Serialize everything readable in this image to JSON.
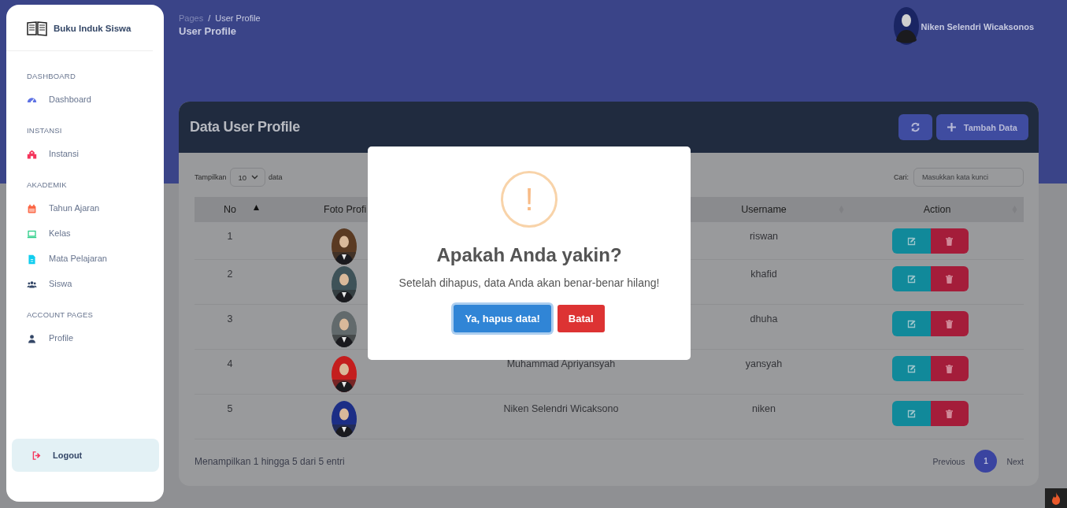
{
  "sidebar": {
    "brand": "Buku Induk Siswa",
    "sections": [
      {
        "title": "DASHBOARD",
        "items": [
          {
            "label": "Dashboard",
            "kind": "gauge"
          }
        ]
      },
      {
        "title": "INSTANSI",
        "items": [
          {
            "label": "Instansi",
            "kind": "building"
          }
        ]
      },
      {
        "title": "AKADEMIK",
        "items": [
          {
            "label": "Tahun Ajaran",
            "kind": "calendar"
          },
          {
            "label": "Kelas",
            "kind": "laptop"
          },
          {
            "label": "Mata Pelajaran",
            "kind": "file"
          },
          {
            "label": "Siswa",
            "kind": "users"
          }
        ]
      },
      {
        "title": "ACCOUNT PAGES",
        "items": [
          {
            "label": "Profile",
            "kind": "user"
          }
        ]
      }
    ],
    "logout": "Logout"
  },
  "header": {
    "breadcrumb": {
      "parent": "Pages",
      "separator": "/",
      "current": "User Profile"
    },
    "title": "User Profile",
    "user_name": "Niken Selendri Wicaksonos"
  },
  "card": {
    "title": "Data User Profile",
    "add_button": "Tambah Data",
    "length": {
      "before": "Tampilkan",
      "value": "10",
      "after": "data"
    },
    "search": {
      "label": "Cari:",
      "placeholder": "Masukkan kata kunci"
    },
    "table": {
      "columns": [
        {
          "label": "No",
          "sorted": true
        },
        {
          "label": "Foto Profi"
        },
        {
          "label": "Username",
          "sorted": false
        },
        {
          "label": "Action",
          "sorted": false
        }
      ],
      "rows": [
        {
          "no": "1",
          "username": "riswan"
        },
        {
          "no": "2",
          "username": "khafid"
        },
        {
          "no": "3",
          "username": "dhuha"
        },
        {
          "no": "4",
          "name": "Muhammad Apriyansyah",
          "username": "yansyah"
        },
        {
          "no": "5",
          "name": "Niken Selendri Wicaksono",
          "username": "niken"
        }
      ]
    },
    "info": "Menampilkan 1 hingga 5 dari 5 entri",
    "pagination": {
      "previous": "Previous",
      "pages": [
        {
          "label": "1",
          "selected": true
        }
      ],
      "next": "Next"
    }
  },
  "modal": {
    "title": "Apakah Anda yakin?",
    "icon_text": "!",
    "message": "Setelah dihapus, data Anda akan benar-benar hilang!",
    "confirm": "Ya, hapus data!",
    "cancel": "Batal"
  }
}
